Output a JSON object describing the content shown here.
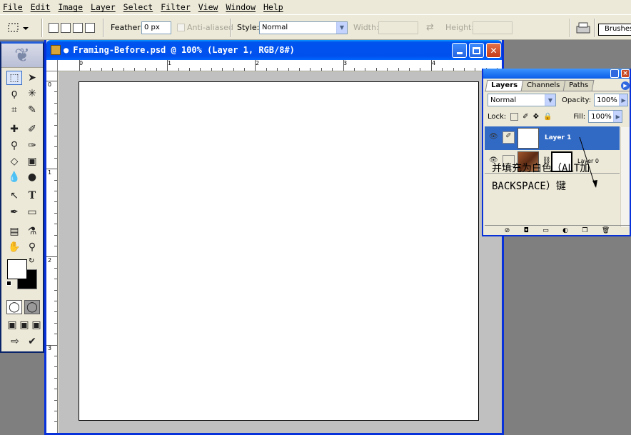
{
  "menu": [
    "File",
    "Edit",
    "Image",
    "Layer",
    "Select",
    "Filter",
    "View",
    "Window",
    "Help"
  ],
  "options": {
    "feather_label": "Feather:",
    "feather_value": "0 px",
    "antialiased_label": "Anti-aliased",
    "style_label": "Style:",
    "style_value": "Normal",
    "width_label": "Width:",
    "height_label": "Height:",
    "brushes_label": "Brushes"
  },
  "document": {
    "title": "Framing-Before.psd @ 100% (Layer 1, RGB/8#)",
    "ruler_h": [
      "0",
      "1",
      "2",
      "3",
      "4"
    ],
    "ruler_v": [
      "0",
      "1",
      "2",
      "3"
    ],
    "canvas_color": "#ffffff"
  },
  "layers_palette": {
    "tabs": [
      "Layers",
      "Channels",
      "Paths"
    ],
    "blend_mode": "Normal",
    "opacity_label": "Opacity:",
    "opacity_value": "100%",
    "lock_label": "Lock:",
    "fill_label": "Fill:",
    "fill_value": "100%",
    "layers": [
      {
        "name": "Layer 1",
        "selected": true
      },
      {
        "name": "Layer 0",
        "selected": false
      }
    ]
  },
  "annotation": {
    "line1": "并填充为白色（ALT加",
    "line2": "BACKSPACE）键"
  },
  "colors": {
    "title_blue": "#0053ee",
    "selected_layer": "#316ac5",
    "workspace": "#7f7f7f",
    "canvas_bg": "#c0c0c0"
  }
}
